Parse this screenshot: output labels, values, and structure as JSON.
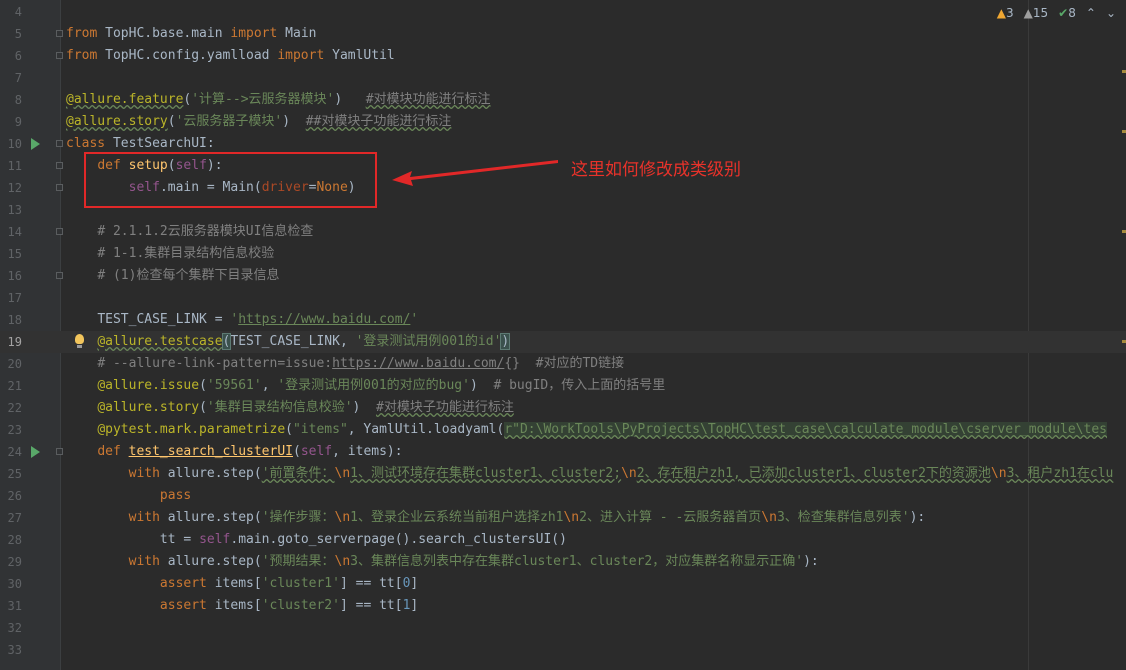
{
  "inspection": {
    "warnings": "3",
    "weak_warnings": "15",
    "ok": "8"
  },
  "annotation": {
    "text": "这里如何修改成类级别"
  },
  "lines": [
    {
      "n": "4"
    },
    {
      "n": "5"
    },
    {
      "n": "6"
    },
    {
      "n": "7"
    },
    {
      "n": "8"
    },
    {
      "n": "9"
    },
    {
      "n": "10"
    },
    {
      "n": "11"
    },
    {
      "n": "12"
    },
    {
      "n": "13"
    },
    {
      "n": "14"
    },
    {
      "n": "15"
    },
    {
      "n": "16"
    },
    {
      "n": "17"
    },
    {
      "n": "18"
    },
    {
      "n": "19"
    },
    {
      "n": "20"
    },
    {
      "n": "21"
    },
    {
      "n": "22"
    },
    {
      "n": "23"
    },
    {
      "n": "24"
    },
    {
      "n": "25"
    },
    {
      "n": "26"
    },
    {
      "n": "27"
    },
    {
      "n": "28"
    },
    {
      "n": "29"
    },
    {
      "n": "30"
    },
    {
      "n": "31"
    },
    {
      "n": "32"
    },
    {
      "n": "33"
    }
  ],
  "code": {
    "l5": [
      "from",
      " TopHC.base.main ",
      "import",
      " Main"
    ],
    "l6": [
      "from",
      " TopHC.config.yamlload ",
      "import",
      " YamlUtil"
    ],
    "l8": [
      "@allure.feature",
      "(",
      "'计算-->云服务器模块'",
      ")   ",
      "#对模块功能进行标注"
    ],
    "l9": [
      "@allure.story",
      "(",
      "'云服务器子模块'",
      ")  ",
      "##对模块子功能进行标注"
    ],
    "l10": [
      "class",
      " TestSearchUI:"
    ],
    "l11": [
      "def",
      " ",
      "setup",
      "(",
      "self",
      "):"
    ],
    "l12": [
      "self",
      ".main = Main(",
      "driver",
      "=",
      "None",
      ")"
    ],
    "l14": "# 2.1.1.2云服务器模块UI信息检查",
    "l15": "# 1-1.集群目录结构信息校验",
    "l16": "# (1)检查每个集群下目录信息",
    "l18": [
      "TEST_CASE_LINK = ",
      "'",
      "https://www.baidu.com/",
      "'"
    ],
    "l19": [
      "@allure.testcase",
      "(",
      "TEST_CASE_LINK, ",
      "'登录测试用例001的id'",
      ")"
    ],
    "l20": [
      "# --allure-link-pattern=issue:",
      "https://www.baidu.com/",
      "{}  #对应的TD链接"
    ],
    "l21": [
      "@allure.issue",
      "(",
      "'59561'",
      ", ",
      "'登录测试用例001的对应的bug'",
      ")  ",
      "# bugID，传入上面的括号里"
    ],
    "l22": [
      "@allure.story",
      "(",
      "'集群目录结构信息校验'",
      ")  ",
      "#对模块子功能进行标注"
    ],
    "l23": [
      "@pytest.mark.parametrize",
      "(",
      "\"items\"",
      ", YamlUtil.loadyaml(",
      "r\"D:\\WorkTools\\PyProjects\\TopHC\\test_case\\calculate_module\\cserver_module\\tes"
    ],
    "l24": [
      "def",
      " ",
      "test_search_clusterUI",
      "(",
      "self",
      ", items):"
    ],
    "l25": [
      "with",
      " allure.step(",
      "'前置条件：",
      "\\n",
      "1、测试环境存在集群cluster1、cluster2;",
      "\\n",
      "2、存在租户zh1, 已添加cluster1、cluster2下的资源池",
      "\\n",
      "3、租户zh1在clu"
    ],
    "l26": [
      "pass"
    ],
    "l27": [
      "with",
      " allure.step(",
      "'操作步骤：",
      "\\n",
      "1、登录企业云系统当前租户选择zh1",
      "\\n",
      "2、进入计算 - -云服务器首页",
      "\\n",
      "3、检查集群信息列表'",
      "):"
    ],
    "l28": [
      "tt = ",
      "self",
      ".main.goto_serverpage().search_clustersUI()"
    ],
    "l29": [
      "with",
      " allure.step(",
      "'预期结果：",
      "\\n",
      "3、集群信息列表中存在集群cluster1、cluster2，对应集群名称显示正确'",
      "):"
    ],
    "l30": [
      "assert",
      " items[",
      "'cluster1'",
      "] == tt[",
      "0",
      "]"
    ],
    "l31": [
      "assert",
      " items[",
      "'cluster2'",
      "] == tt[",
      "1",
      "]"
    ]
  }
}
